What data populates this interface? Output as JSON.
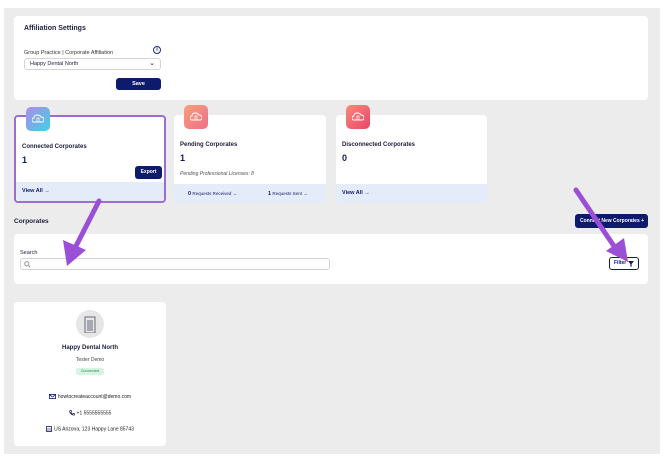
{
  "affiliation": {
    "title": "Affiliation Settings",
    "field_label": "Group Practice | Corporate Affiliation",
    "selected": "Happy Dental North",
    "save_label": "Save"
  },
  "cards": {
    "connected": {
      "title": "Connected Corporates",
      "count": "1",
      "export_label": "Export",
      "view_all": "View All →"
    },
    "pending": {
      "title": "Pending Corporates",
      "count": "1",
      "licenses_text": "Pending Professional Licenses: 8",
      "requests_received_count": "0",
      "requests_received_label": "Requests Received →",
      "requests_sent_count": "1",
      "requests_sent_label": "Requests Sent →"
    },
    "disconnected": {
      "title": "Disconnected Corporates",
      "count": "0",
      "view_all": "View All →"
    }
  },
  "corporates": {
    "heading": "Corporates",
    "connect_label": "Connect New Corporates +",
    "search_label": "Search",
    "search_placeholder": "",
    "filter_label": "Filter"
  },
  "result": {
    "name": "Happy Dental North",
    "contact": "Tester Demo",
    "status": "Connected",
    "email": "howtocreateaccount@demo.com",
    "phone": "+1 5555555555",
    "address": "US Arizona, 123 Happy Lane 85743"
  },
  "colors": {
    "primary": "#0e1a6b",
    "annotation_arrow": "#9b4fd6",
    "status_green": "#1e8a4a"
  },
  "icons": {
    "card_icon": "building-cloud-icon",
    "info": "info-icon",
    "chevron": "chevron-down-icon",
    "search": "search-icon",
    "filter": "filter-funnel-icon",
    "avatar": "building-icon",
    "email": "envelope-icon",
    "phone": "phone-icon",
    "address": "location-building-icon"
  }
}
